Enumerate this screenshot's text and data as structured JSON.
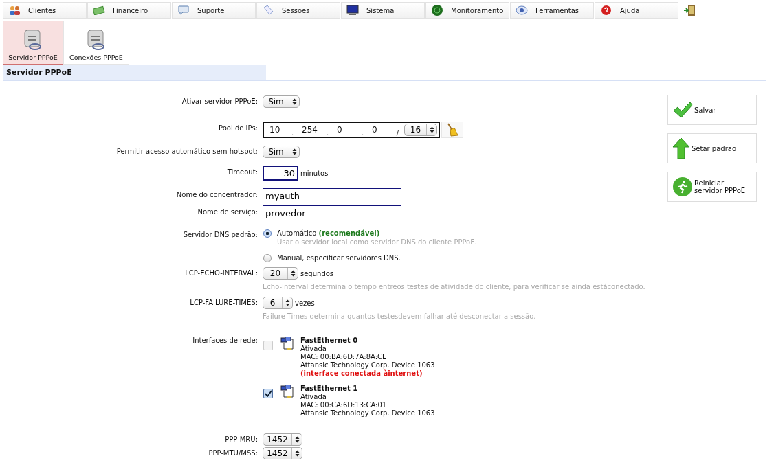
{
  "menu": [
    {
      "label": "Clientes"
    },
    {
      "label": "Financeiro"
    },
    {
      "label": "Suporte"
    },
    {
      "label": "Sessões"
    },
    {
      "label": "Sistema"
    },
    {
      "label": "Monitoramento"
    },
    {
      "label": "Ferramentas"
    },
    {
      "label": "Ajuda"
    }
  ],
  "subtabs": [
    {
      "label": "Servidor PPPoE",
      "selected": true
    },
    {
      "label": "Conexões PPPoE",
      "selected": false
    }
  ],
  "section_title": "Servidor PPPoE",
  "fields": [
    {
      "kind": "select",
      "label": "Ativar servidor PPPoE:",
      "value": "Sim"
    },
    {
      "kind": "ip_pool",
      "label": "Pool de IPs:",
      "octets": [
        "10",
        "254",
        "0",
        "0"
      ],
      "octet_separator": ".",
      "prefix_separator": "/",
      "prefix": "16"
    },
    {
      "kind": "select",
      "label": "Permitir acesso automático sem hotspot:",
      "value": "Sim"
    },
    {
      "kind": "number",
      "label": "Timeout:",
      "value": "30",
      "unit": "minutos"
    },
    {
      "kind": "text",
      "label": "Nome do concentrador:",
      "value": "myauth"
    },
    {
      "kind": "text",
      "label": "Nome de serviço:",
      "value": "provedor"
    },
    {
      "kind": "radio",
      "label": "Servidor DNS padrão:",
      "options": [
        {
          "label": "Automático **(recomendável)**",
          "hint": "Usar o servidor local como servidor DNS do cliente PPPoE.",
          "selected": true
        },
        {
          "label": "Manual, especificar servidores DNS.",
          "selected": false
        }
      ]
    },
    {
      "kind": "select",
      "label": "LCP-ECHO-INTERVAL:",
      "value": "20",
      "unit": "segundos",
      "hint": "Echo-Interval determina o tempo entreos testes de atividade do cliente, para verificar se ainda estáconectado."
    },
    {
      "kind": "select",
      "label": "LCP-FAILURE-TIMES:",
      "value": "6",
      "unit": "vezes",
      "hint": "Failure-Times determina quantos testesdevem falhar até desconectar a sessão."
    },
    {
      "kind": "interfaces",
      "label": "Interfaces de rede:",
      "items": [
        {
          "name": "FastEthernet 0",
          "status": "Ativada",
          "mac": "MAC: 00:BA:6D:7A:8A:CE",
          "device": "Attansic Technology Corp. Device 1063",
          "warning": "(interface conectada àinternet)",
          "checked": false,
          "disabled": true
        },
        {
          "name": "FastEthernet 1",
          "status": "Ativada",
          "mac": "MAC: 00:CA:6D:13:CA:01",
          "device": "Attansic Technology Corp. Device 1063",
          "checked": true,
          "disabled": false
        }
      ]
    },
    {
      "kind": "select",
      "label": "PPP-MRU:",
      "value": "1452"
    },
    {
      "kind": "select",
      "label": "PPP-MTU/MSS:",
      "value": "1452"
    }
  ],
  "actions": [
    {
      "label": "Salvar"
    },
    {
      "label": "Setar padrão"
    },
    {
      "label": "Reiniciar servidor PPPoE"
    }
  ]
}
